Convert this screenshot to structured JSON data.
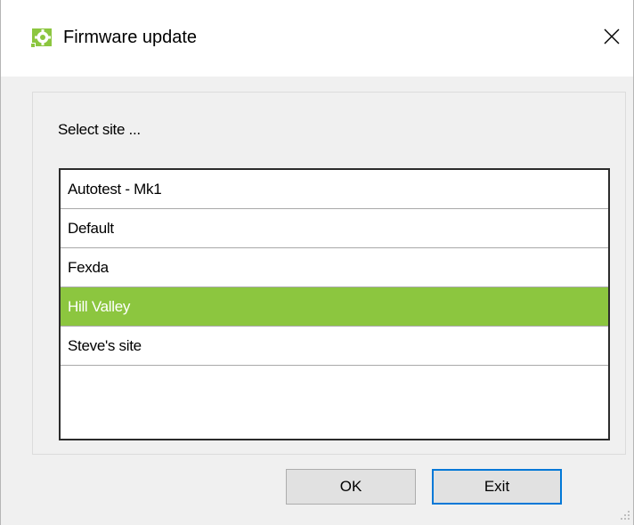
{
  "dialog": {
    "title": "Firmware update",
    "prompt": "Select site ...",
    "sites": [
      {
        "label": "Autotest - Mk1",
        "selected": false
      },
      {
        "label": "Default",
        "selected": false
      },
      {
        "label": "Fexda",
        "selected": false
      },
      {
        "label": "Hill Valley",
        "selected": true
      },
      {
        "label": "Steve's site",
        "selected": false
      }
    ],
    "ok_label": "OK",
    "exit_label": "Exit"
  },
  "colors": {
    "selection": "#8cc63f",
    "default_button_border": "#0078d7",
    "app_icon": "#8cc63f"
  },
  "icons": {
    "app": "gear-icon",
    "close": "close-icon",
    "grip": "resize-grip-icon"
  }
}
